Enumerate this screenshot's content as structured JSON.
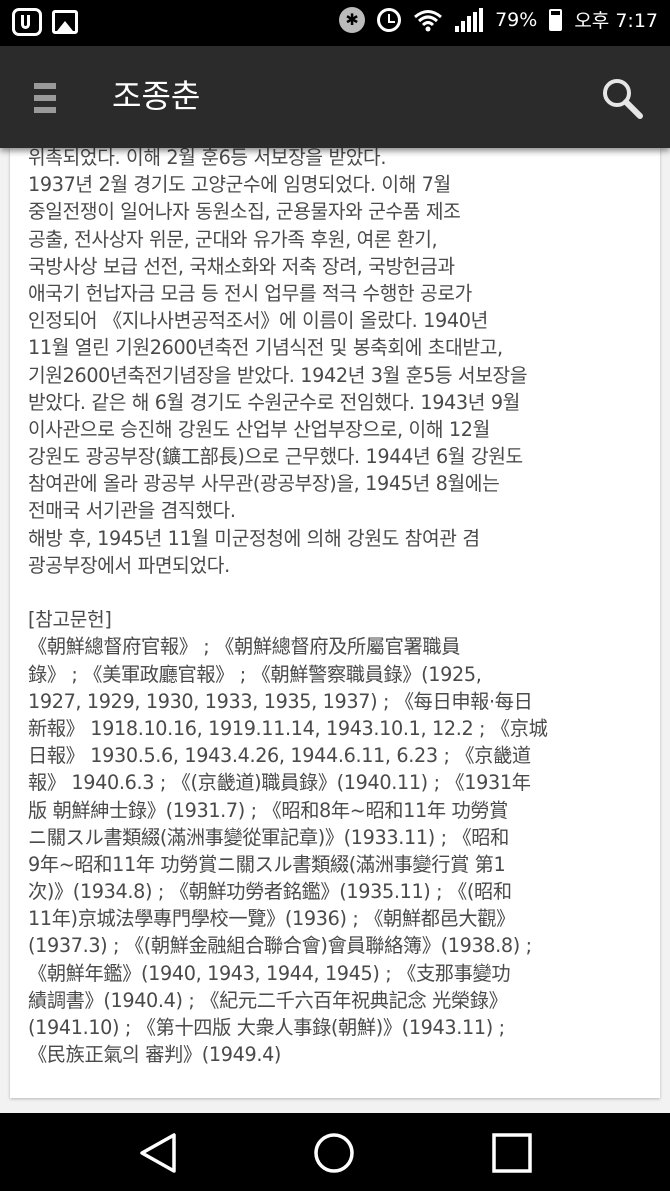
{
  "status_bar": {
    "battery": "79%",
    "time": "오후 7:17",
    "icons": [
      "app-notification-icon",
      "gallery-icon",
      "bluetooth-icon",
      "alarm-icon",
      "wifi-icon",
      "signal-icon",
      "battery-icon"
    ]
  },
  "app_bar": {
    "title": "조종춘",
    "menu_icon": "hamburger-menu-icon",
    "search_icon": "search-icon"
  },
  "article": {
    "lines": [
      "위촉되었다. 이해 2월 훈6등 서보장을 받았다.",
      "1937년 2월 경기도 고양군수에 임명되었다. 이해 7월",
      "중일전쟁이 일어나자 동원소집, 군용물자와 군수품 제조",
      "공출, 전사상자 위문, 군대와 유가족 후원, 여론 환기,",
      "국방사상 보급 선전, 국채소화와 저축 장려, 국방헌금과",
      "애국기 헌납자금 모금 등 전시 업무를 적극 수행한 공로가",
      "인정되어 《지나사변공적조서》에 이름이 올랐다. 1940년",
      "11월 열린 기원2600년축전 기념식전 및 봉축회에 초대받고,",
      "기원2600년축전기념장을 받았다. 1942년 3월 훈5등 서보장을",
      "받았다. 같은 해 6월 경기도 수원군수로 전임했다. 1943년 9월",
      "이사관으로 승진해 강원도 산업부 산업부장으로, 이해 12월",
      "강원도 광공부장(鑛工部長)으로 근무했다. 1944년 6월 강원도",
      "참여관에 올라 광공부 사무관(광공부장)을, 1945년 8월에는",
      "전매국 서기관을 겸직했다.",
      "해방 후, 1945년 11월 미군정청에 의해 강원도 참여관 겸",
      "광공부장에서 파면되었다.",
      "",
      "[참고문헌]",
      "《朝鮮總督府官報》 ; 《朝鮮總督府及所屬官署職員",
      "錄》 ; 《美軍政廳官報》 ; 《朝鮮警察職員錄》(1925,",
      "1927, 1929, 1930, 1933, 1935, 1937) ; 《每日申報·每日",
      "新報》 1918.10.16, 1919.11.14, 1943.10.1, 12.2 ; 《京城",
      "日報》 1930.5.6, 1943.4.26, 1944.6.11, 6.23 ; 《京畿道",
      "報》 1940.6.3 ; 《(京畿道)職員錄》(1940.11) ; 《1931年",
      "版 朝鮮紳士錄》(1931.7) ; 《昭和8年~昭和11年 功勞賞",
      "ニ關スル書類綴(滿洲事變從軍記章)》(1933.11) ; 《昭和",
      "9年~昭和11年 功勞賞ニ關スル書類綴(滿洲事變行賞 第1",
      "次)》(1934.8) ; 《朝鮮功勞者銘鑑》(1935.11) ; 《(昭和",
      "11年)京城法學專門學校一覽》(1936) ; 《朝鮮都邑大觀》",
      "(1937.3) ; 《(朝鮮金融組合聯合會)會員聯絡簿》(1938.8) ;",
      "《朝鮮年鑑》(1940, 1943, 1944, 1945) ; 《支那事變功",
      "績調書》(1940.4) ; 《紀元二千六百年祝典記念 光榮錄》",
      "(1941.10) ; 《第十四版 大衆人事錄(朝鮮)》(1943.11) ;",
      "《民族正氣의 審判》(1949.4)"
    ]
  },
  "nav_bar": {
    "icons": [
      "back-icon",
      "home-icon",
      "recent-apps-icon"
    ]
  }
}
